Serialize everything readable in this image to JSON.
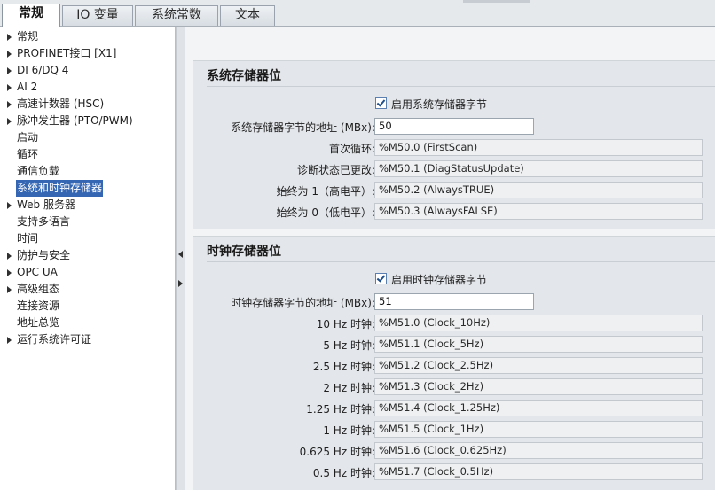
{
  "tabs": [
    "常规",
    "IO 变量",
    "系统常数",
    "文本"
  ],
  "nav": {
    "items": [
      {
        "label": "常规",
        "expandable": true
      },
      {
        "label": "PROFINET接口 [X1]",
        "expandable": true
      },
      {
        "label": "DI 6/DQ 4",
        "expandable": true
      },
      {
        "label": "AI 2",
        "expandable": true
      },
      {
        "label": "高速计数器 (HSC)",
        "expandable": true
      },
      {
        "label": "脉冲发生器 (PTO/PWM)",
        "expandable": true
      },
      {
        "label": "启动",
        "expandable": false
      },
      {
        "label": "循环",
        "expandable": false
      },
      {
        "label": "通信负载",
        "expandable": false
      },
      {
        "label": "系统和时钟存储器",
        "expandable": false,
        "selected": true
      },
      {
        "label": "Web 服务器",
        "expandable": true
      },
      {
        "label": "支持多语言",
        "expandable": false
      },
      {
        "label": "时间",
        "expandable": false
      },
      {
        "label": "防护与安全",
        "expandable": true
      },
      {
        "label": "OPC UA",
        "expandable": true
      },
      {
        "label": "高级组态",
        "expandable": true
      },
      {
        "label": "连接资源",
        "expandable": false
      },
      {
        "label": "地址总览",
        "expandable": false
      },
      {
        "label": "运行系统许可证",
        "expandable": true
      }
    ]
  },
  "system_memory": {
    "title": "系统存储器位",
    "enable_label": "启用系统存储器字节",
    "enabled": true,
    "address_label": "系统存储器字节的地址 (MBx):",
    "address_value": "50",
    "rows": [
      {
        "label": "首次循环:",
        "value": "%M50.0 (FirstScan)"
      },
      {
        "label": "诊断状态已更改:",
        "value": "%M50.1 (DiagStatusUpdate)"
      },
      {
        "label": "始终为 1（高电平）:",
        "value": "%M50.2 (AlwaysTRUE)"
      },
      {
        "label": "始终为 0（低电平）:",
        "value": "%M50.3 (AlwaysFALSE)"
      }
    ]
  },
  "clock_memory": {
    "title": "时钟存储器位",
    "enable_label": "启用时钟存储器字节",
    "enabled": true,
    "address_label": "时钟存储器字节的地址 (MBx):",
    "address_value": "51",
    "rows": [
      {
        "label": "10 Hz 时钟:",
        "value": "%M51.0 (Clock_10Hz)"
      },
      {
        "label": "5 Hz 时钟:",
        "value": "%M51.1 (Clock_5Hz)"
      },
      {
        "label": "2.5 Hz 时钟:",
        "value": "%M51.2 (Clock_2.5Hz)"
      },
      {
        "label": "2 Hz 时钟:",
        "value": "%M51.3 (Clock_2Hz)"
      },
      {
        "label": "1.25 Hz 时钟:",
        "value": "%M51.4 (Clock_1.25Hz)"
      },
      {
        "label": "1 Hz 时钟:",
        "value": "%M51.5 (Clock_1Hz)"
      },
      {
        "label": "0.625 Hz 时钟:",
        "value": "%M51.6 (Clock_0.625Hz)"
      },
      {
        "label": "0.5 Hz 时钟:",
        "value": "%M51.7 (Clock_0.5Hz)"
      }
    ]
  }
}
